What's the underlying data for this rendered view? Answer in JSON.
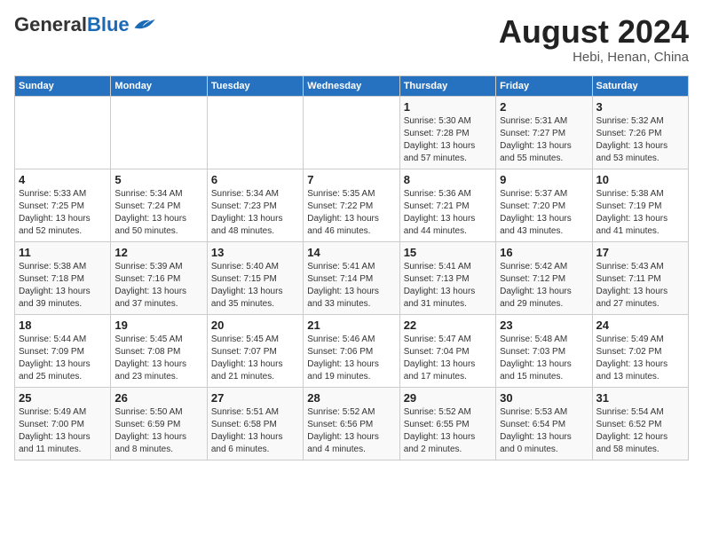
{
  "header": {
    "logo_general": "General",
    "logo_blue": "Blue",
    "month_year": "August 2024",
    "location": "Hebi, Henan, China"
  },
  "days_of_week": [
    "Sunday",
    "Monday",
    "Tuesday",
    "Wednesday",
    "Thursday",
    "Friday",
    "Saturday"
  ],
  "weeks": [
    [
      {
        "day": "",
        "info": ""
      },
      {
        "day": "",
        "info": ""
      },
      {
        "day": "",
        "info": ""
      },
      {
        "day": "",
        "info": ""
      },
      {
        "day": "1",
        "info": "Sunrise: 5:30 AM\nSunset: 7:28 PM\nDaylight: 13 hours\nand 57 minutes."
      },
      {
        "day": "2",
        "info": "Sunrise: 5:31 AM\nSunset: 7:27 PM\nDaylight: 13 hours\nand 55 minutes."
      },
      {
        "day": "3",
        "info": "Sunrise: 5:32 AM\nSunset: 7:26 PM\nDaylight: 13 hours\nand 53 minutes."
      }
    ],
    [
      {
        "day": "4",
        "info": "Sunrise: 5:33 AM\nSunset: 7:25 PM\nDaylight: 13 hours\nand 52 minutes."
      },
      {
        "day": "5",
        "info": "Sunrise: 5:34 AM\nSunset: 7:24 PM\nDaylight: 13 hours\nand 50 minutes."
      },
      {
        "day": "6",
        "info": "Sunrise: 5:34 AM\nSunset: 7:23 PM\nDaylight: 13 hours\nand 48 minutes."
      },
      {
        "day": "7",
        "info": "Sunrise: 5:35 AM\nSunset: 7:22 PM\nDaylight: 13 hours\nand 46 minutes."
      },
      {
        "day": "8",
        "info": "Sunrise: 5:36 AM\nSunset: 7:21 PM\nDaylight: 13 hours\nand 44 minutes."
      },
      {
        "day": "9",
        "info": "Sunrise: 5:37 AM\nSunset: 7:20 PM\nDaylight: 13 hours\nand 43 minutes."
      },
      {
        "day": "10",
        "info": "Sunrise: 5:38 AM\nSunset: 7:19 PM\nDaylight: 13 hours\nand 41 minutes."
      }
    ],
    [
      {
        "day": "11",
        "info": "Sunrise: 5:38 AM\nSunset: 7:18 PM\nDaylight: 13 hours\nand 39 minutes."
      },
      {
        "day": "12",
        "info": "Sunrise: 5:39 AM\nSunset: 7:16 PM\nDaylight: 13 hours\nand 37 minutes."
      },
      {
        "day": "13",
        "info": "Sunrise: 5:40 AM\nSunset: 7:15 PM\nDaylight: 13 hours\nand 35 minutes."
      },
      {
        "day": "14",
        "info": "Sunrise: 5:41 AM\nSunset: 7:14 PM\nDaylight: 13 hours\nand 33 minutes."
      },
      {
        "day": "15",
        "info": "Sunrise: 5:41 AM\nSunset: 7:13 PM\nDaylight: 13 hours\nand 31 minutes."
      },
      {
        "day": "16",
        "info": "Sunrise: 5:42 AM\nSunset: 7:12 PM\nDaylight: 13 hours\nand 29 minutes."
      },
      {
        "day": "17",
        "info": "Sunrise: 5:43 AM\nSunset: 7:11 PM\nDaylight: 13 hours\nand 27 minutes."
      }
    ],
    [
      {
        "day": "18",
        "info": "Sunrise: 5:44 AM\nSunset: 7:09 PM\nDaylight: 13 hours\nand 25 minutes."
      },
      {
        "day": "19",
        "info": "Sunrise: 5:45 AM\nSunset: 7:08 PM\nDaylight: 13 hours\nand 23 minutes."
      },
      {
        "day": "20",
        "info": "Sunrise: 5:45 AM\nSunset: 7:07 PM\nDaylight: 13 hours\nand 21 minutes."
      },
      {
        "day": "21",
        "info": "Sunrise: 5:46 AM\nSunset: 7:06 PM\nDaylight: 13 hours\nand 19 minutes."
      },
      {
        "day": "22",
        "info": "Sunrise: 5:47 AM\nSunset: 7:04 PM\nDaylight: 13 hours\nand 17 minutes."
      },
      {
        "day": "23",
        "info": "Sunrise: 5:48 AM\nSunset: 7:03 PM\nDaylight: 13 hours\nand 15 minutes."
      },
      {
        "day": "24",
        "info": "Sunrise: 5:49 AM\nSunset: 7:02 PM\nDaylight: 13 hours\nand 13 minutes."
      }
    ],
    [
      {
        "day": "25",
        "info": "Sunrise: 5:49 AM\nSunset: 7:00 PM\nDaylight: 13 hours\nand 11 minutes."
      },
      {
        "day": "26",
        "info": "Sunrise: 5:50 AM\nSunset: 6:59 PM\nDaylight: 13 hours\nand 8 minutes."
      },
      {
        "day": "27",
        "info": "Sunrise: 5:51 AM\nSunset: 6:58 PM\nDaylight: 13 hours\nand 6 minutes."
      },
      {
        "day": "28",
        "info": "Sunrise: 5:52 AM\nSunset: 6:56 PM\nDaylight: 13 hours\nand 4 minutes."
      },
      {
        "day": "29",
        "info": "Sunrise: 5:52 AM\nSunset: 6:55 PM\nDaylight: 13 hours\nand 2 minutes."
      },
      {
        "day": "30",
        "info": "Sunrise: 5:53 AM\nSunset: 6:54 PM\nDaylight: 13 hours\nand 0 minutes."
      },
      {
        "day": "31",
        "info": "Sunrise: 5:54 AM\nSunset: 6:52 PM\nDaylight: 12 hours\nand 58 minutes."
      }
    ]
  ]
}
